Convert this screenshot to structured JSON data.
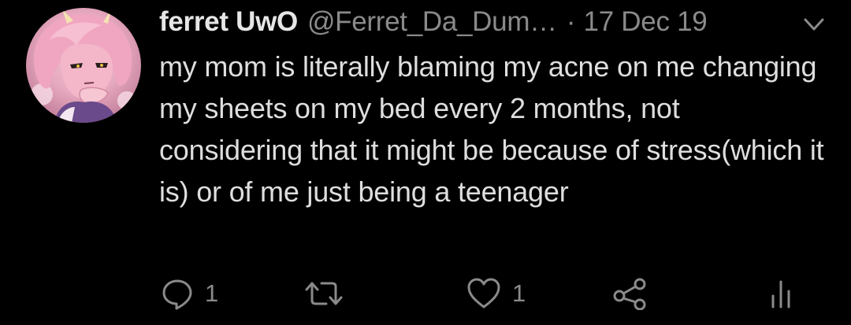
{
  "tweet": {
    "display_name": "ferret UwO",
    "handle": "@Ferret_Da_Dum…",
    "separator": "·",
    "timestamp": "17 Dec 19",
    "text": "my mom is literally blaming my acne on me changing my sheets on my bed every 2 months, not considering that it might be because of stress(which it is) or of me just being a teenager",
    "avatar_icon": "anime-avatar-pink-hair"
  },
  "actions": {
    "reply": {
      "icon": "reply-icon",
      "count": "1"
    },
    "retweet": {
      "icon": "retweet-icon",
      "count": ""
    },
    "like": {
      "icon": "heart-icon",
      "count": "1"
    },
    "share": {
      "icon": "share-icon"
    },
    "analytics": {
      "icon": "analytics-icon"
    },
    "caret": {
      "icon": "chevron-down-icon"
    }
  },
  "colors": {
    "background": "#000000",
    "text_primary": "#dedede",
    "text_secondary": "#8a8a8a",
    "icon": "#8a8a8a"
  }
}
